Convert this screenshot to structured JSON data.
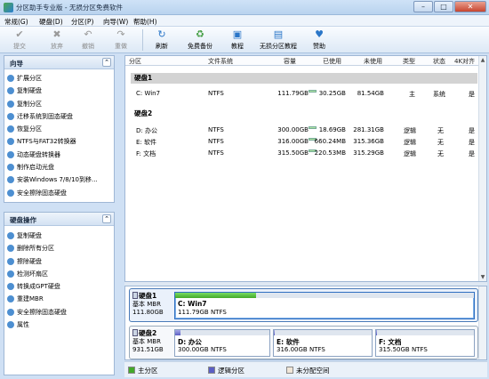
{
  "window": {
    "title": "分区助手专业版 - 无损分区免费软件"
  },
  "menu": [
    "常规(G)",
    "硬盘(D)",
    "分区(P)",
    "向导(W)",
    "帮助(H)"
  ],
  "toolbar": {
    "submit": "提交",
    "discard": "放弃",
    "undo": "撤销",
    "redo": "重做",
    "refresh": "刷新",
    "free_backup": "免费备份",
    "tutorial": "教程",
    "lossless_tutorial": "无损分区教程",
    "donate": "赞助"
  },
  "wizard_panel": {
    "title": "向导",
    "items": [
      "扩展分区",
      "复制硬盘",
      "复制分区",
      "迁移系统到固态硬盘",
      "恢复分区",
      "NTFS与FAT32转换器",
      "动态硬盘转换器",
      "制作启动光盘",
      "安装Windows 7/8/10到移...",
      "安全擦除固态硬盘"
    ]
  },
  "disk_ops_panel": {
    "title": "硬盘操作",
    "items": [
      "复制硬盘",
      "删除所有分区",
      "擦除硬盘",
      "检测坏扇区",
      "转换成GPT硬盘",
      "重建MBR",
      "安全擦除固态硬盘",
      "属性"
    ]
  },
  "table": {
    "headers": [
      "分区",
      "文件系统",
      "容量",
      "已使用",
      "未使用",
      "类型",
      "状态",
      "4K对齐"
    ],
    "disk1_label": "硬盘1",
    "disk2_label": "硬盘2",
    "rows": [
      {
        "name": "C: Win7",
        "fs": "NTFS",
        "capacity": "111.79GB",
        "used": "30.25GB",
        "unused": "81.54GB",
        "type": "主",
        "status": "系统",
        "align": "是",
        "used_frac": 0.27
      },
      {
        "name": "D: 办公",
        "fs": "NTFS",
        "capacity": "300.00GB",
        "used": "18.69GB",
        "unused": "281.31GB",
        "type": "逻辑",
        "status": "无",
        "align": "是",
        "used_frac": 0.06
      },
      {
        "name": "E: 软件",
        "fs": "NTFS",
        "capacity": "316.00GB",
        "used": "660.24MB",
        "unused": "315.36GB",
        "type": "逻辑",
        "status": "无",
        "align": "是",
        "used_frac": 0.01
      },
      {
        "name": "F: 文档",
        "fs": "NTFS",
        "capacity": "315.50GB",
        "used": "220.53MB",
        "unused": "315.29GB",
        "type": "逻辑",
        "status": "无",
        "align": "是",
        "used_frac": 0.01
      }
    ]
  },
  "disk_map": {
    "disk1": {
      "name": "硬盘1",
      "kind": "基本 MBR",
      "size": "111.80GB",
      "partitions": [
        {
          "name": "C: Win7",
          "size": "111.79GB NTFS",
          "used_frac": 0.27
        }
      ]
    },
    "disk2": {
      "name": "硬盘2",
      "kind": "基本 MBR",
      "size": "931.51GB",
      "partitions": [
        {
          "name": "D: 办公",
          "size": "300.00GB NTFS",
          "used_frac": 0.06
        },
        {
          "name": "E: 软件",
          "size": "316.00GB NTFS",
          "used_frac": 0.01
        },
        {
          "name": "F: 文档",
          "size": "315.50GB NTFS",
          "used_frac": 0.01
        }
      ]
    }
  },
  "legend": {
    "primary": "主分区",
    "logical": "逻辑分区",
    "unallocated": "未分配空间"
  },
  "colors": {
    "primary": "#43a92a",
    "logical": "#5b5fc4",
    "unallocated": "#f0e6d8",
    "selected_row": "#d3d3d3"
  }
}
